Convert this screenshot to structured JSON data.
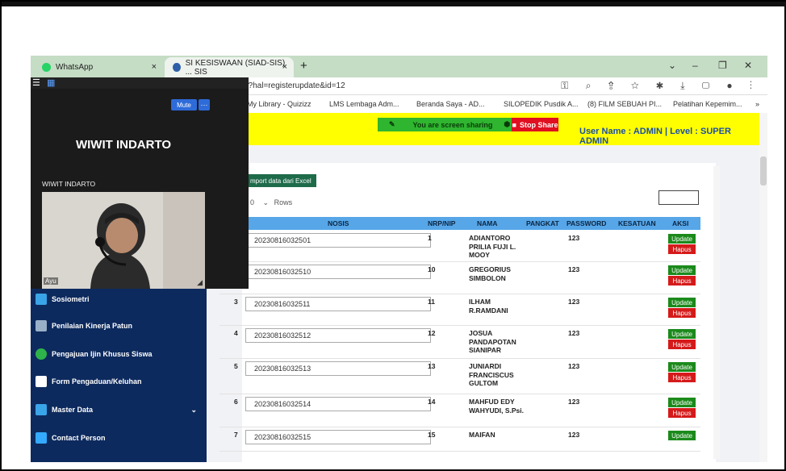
{
  "browser": {
    "tabs": [
      {
        "label": "WhatsApp",
        "close": "×"
      },
      {
        "label": "SI KESISWAAN (SIAD-SIS) ... SIS",
        "close": "×"
      }
    ],
    "new_tab": "+",
    "window_controls": [
      "⌄",
      "–",
      "❐",
      "✕"
    ],
    "url": "p?hal=registerupdate&id=12",
    "bookmarks": [
      "My Library - Quizizz",
      "LMS Lembaga Adm...",
      "Beranda Saya - AD...",
      "SILOPEDIK Pusdik A...",
      "(8) FILM SEBUAH PI...",
      "Pelatihan Kepemim..."
    ],
    "bookmarks_more": "»"
  },
  "share": {
    "status": "You are screen sharing",
    "stop": "Stop Share"
  },
  "header": {
    "user_info": "User Name : ADMIN | Level : SUPER ADMIN"
  },
  "zoom": {
    "mute": "Mute",
    "more": "···",
    "host_name": "WIWIT INDARTO",
    "host_small": "WIWIT INDARTO",
    "cam_label": "Ayu"
  },
  "sidebar": {
    "items": [
      {
        "label": "Sosiometri",
        "color": "#3aa4e8"
      },
      {
        "label": "Penilaian Kinerja Patun",
        "color": "#9ab0c8"
      },
      {
        "label": "Pengajuan Ijin Khusus Siswa",
        "color": "#2db34a"
      },
      {
        "label": "Form Pengaduan/Keluhan",
        "color": "#ffffff"
      },
      {
        "label": "Master Data",
        "color": "#3aa4e8"
      },
      {
        "label": "Contact Person",
        "color": "#33aaff"
      }
    ]
  },
  "table": {
    "import_button": "mport data dari Excel",
    "rows_label": "Rows",
    "rows_prefix": "0",
    "columns": [
      "NOSIS",
      "NRP/NIP",
      "NAMA",
      "PANGKAT",
      "PASSWORD",
      "KESATUAN",
      "AKSI"
    ],
    "update_label": "Update",
    "delete_label": "Hapus",
    "rows": [
      {
        "no": "",
        "nosis": "20230816032501",
        "nrp": "1",
        "nama": "ADIANTORO PRILIA FUJI L. MOOY",
        "pangkat": "",
        "password": "123",
        "kesatuan": ""
      },
      {
        "no": "",
        "nosis": "20230816032510",
        "nrp": "10",
        "nama": "GREGORIUS SIMBOLON",
        "pangkat": "",
        "password": "123",
        "kesatuan": ""
      },
      {
        "no": "3",
        "nosis": "20230816032511",
        "nrp": "11",
        "nama": "ILHAM R.RAMDANI",
        "pangkat": "",
        "password": "123",
        "kesatuan": ""
      },
      {
        "no": "4",
        "nosis": "20230816032512",
        "nrp": "12",
        "nama": "JOSUA PANDAPOTAN SIANIPAR",
        "pangkat": "",
        "password": "123",
        "kesatuan": ""
      },
      {
        "no": "5",
        "nosis": "20230816032513",
        "nrp": "13",
        "nama": "JUNIARDI FRANCISCUS GULTOM",
        "pangkat": "",
        "password": "123",
        "kesatuan": ""
      },
      {
        "no": "6",
        "nosis": "20230816032514",
        "nrp": "14",
        "nama": "MAHFUD EDY WAHYUDI, S.Psi.",
        "pangkat": "",
        "password": "123",
        "kesatuan": ""
      },
      {
        "no": "7",
        "nosis": "20230816032515",
        "nrp": "15",
        "nama": "MAIFAN",
        "pangkat": "",
        "password": "123",
        "kesatuan": ""
      }
    ]
  }
}
